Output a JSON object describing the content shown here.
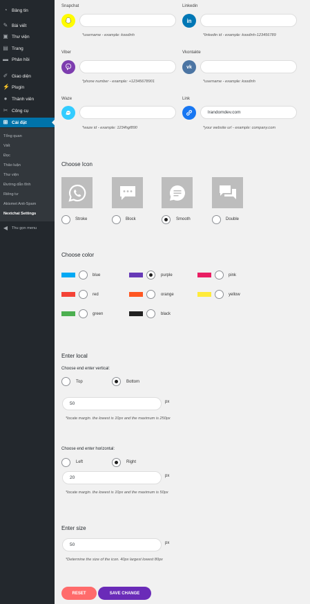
{
  "sidebar": {
    "items": [
      {
        "label": "Bảng tin",
        "icon": "dashboard-icon"
      },
      {
        "label": "Bài viết",
        "icon": "pin-icon"
      },
      {
        "label": "Thư viện",
        "icon": "media-icon"
      },
      {
        "label": "Trang",
        "icon": "page-icon"
      },
      {
        "label": "Phản hồi",
        "icon": "comment-icon"
      },
      {
        "label": "Giao diện",
        "icon": "brush-icon"
      },
      {
        "label": "Plugin",
        "icon": "plugin-icon"
      },
      {
        "label": "Thành viên",
        "icon": "users-icon"
      },
      {
        "label": "Công cụ",
        "icon": "wrench-icon"
      },
      {
        "label": "Cài đặt",
        "icon": "settings-icon"
      }
    ],
    "submenu": [
      "Tổng quan",
      "Viết",
      "Đọc",
      "Thảo luận",
      "Thư viện",
      "Đường dẫn tĩnh",
      "Riêng tư",
      "Akismet Anti-Spam",
      "Nextchat Settings"
    ],
    "collapse_label": "Thu gọn menu"
  },
  "channels": {
    "snapchat": {
      "label": "Snapchat",
      "value": "",
      "hint": "*username - example: koodinh",
      "color": "#fffc00"
    },
    "linkedin": {
      "label": "Linkedin",
      "value": "",
      "hint": "*linkedin id - example: koodinh-123456789",
      "color": "#0077b5"
    },
    "viber": {
      "label": "Viber",
      "value": "",
      "hint": "*phone number - example: +12345678901",
      "color": "#7d3daf"
    },
    "vkontakte": {
      "label": "Vkontakte",
      "value": "",
      "hint": "*username - example: koodinh",
      "color": "#4c75a3"
    },
    "waze": {
      "label": "Waze",
      "value": "",
      "hint": "*waze id - example: 1234hgf890",
      "color": "#33ccff"
    },
    "link": {
      "label": "Link",
      "value": "lrandomdev.com",
      "hint": "*your website url - example: company.com",
      "color": "#1877f2"
    }
  },
  "choose_icon": {
    "title": "Choose Icon",
    "options": [
      {
        "label": "Stroke",
        "icon": "whatsapp-icon",
        "checked": false
      },
      {
        "label": "Block",
        "icon": "chat-dots-icon",
        "checked": false
      },
      {
        "label": "Smooth",
        "icon": "chat-bubble-icon",
        "checked": true
      },
      {
        "label": "Double",
        "icon": "chat-double-icon",
        "checked": false
      }
    ]
  },
  "choose_color": {
    "title": "Choose color",
    "options": [
      {
        "label": "blue",
        "color": "#03a9f4",
        "checked": false
      },
      {
        "label": "purple",
        "color": "#673ab7",
        "checked": true
      },
      {
        "label": "pink",
        "color": "#e91e63",
        "checked": false
      },
      {
        "label": "red",
        "color": "#f44336",
        "checked": false
      },
      {
        "label": "orange",
        "color": "#ff5722",
        "checked": false
      },
      {
        "label": "yellow",
        "color": "#ffeb3b",
        "checked": false
      },
      {
        "label": "green",
        "color": "#4caf50",
        "checked": false
      },
      {
        "label": "black",
        "color": "#212121",
        "checked": false
      }
    ]
  },
  "enter_local": {
    "title": "Enter local",
    "vertical": {
      "label": "Choose end enter vertical:",
      "options": [
        {
          "label": "Top",
          "checked": false
        },
        {
          "label": "Bottom",
          "checked": true
        }
      ],
      "value": "50",
      "unit": "px",
      "hint": "*locate margin. the lowest is 10px and the maximum is 250px"
    },
    "horizontal": {
      "label": "Choose end enter horizontal:",
      "options": [
        {
          "label": "Left",
          "checked": false
        },
        {
          "label": "Right",
          "checked": true
        }
      ],
      "value": "20",
      "unit": "px",
      "hint": "*locate margin. the lowest is 10px and the maximum is 50px"
    }
  },
  "enter_size": {
    "title": "Enter size",
    "value": "50",
    "unit": "px",
    "hint": "*Determine the size of the icon. 40px largest lowest 80px"
  },
  "buttons": {
    "reset": "RESET",
    "save": "SAVE CHANGE",
    "reset_color": "#ff6b6b",
    "save_color": "#6a2bb8"
  }
}
